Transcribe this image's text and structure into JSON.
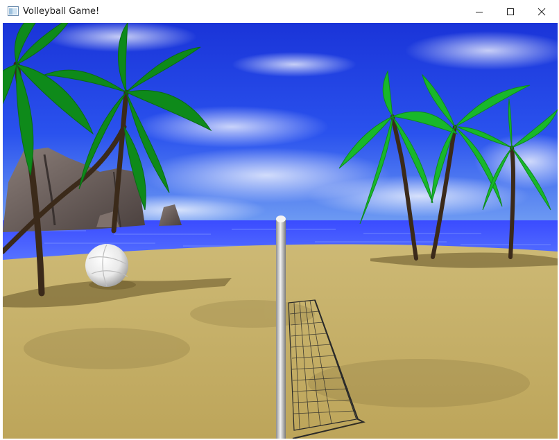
{
  "window": {
    "title": "Volleyball Game!",
    "icon": "app-window-icon",
    "controls": [
      "minimize-icon",
      "maximize-icon",
      "close-icon"
    ]
  },
  "scene": {
    "objects": [
      "sky",
      "clouds",
      "ocean",
      "rock-cliffs",
      "palm-trees",
      "sand-beach",
      "volleyball",
      "net-post",
      "net"
    ],
    "colors": {
      "sky": "#1f3fe0",
      "ocean": "#3a55ff",
      "sand": "#c9b46a",
      "palm": "#1fae2a",
      "ball": "#f4f4f4",
      "post": "#c8c8c8"
    }
  }
}
